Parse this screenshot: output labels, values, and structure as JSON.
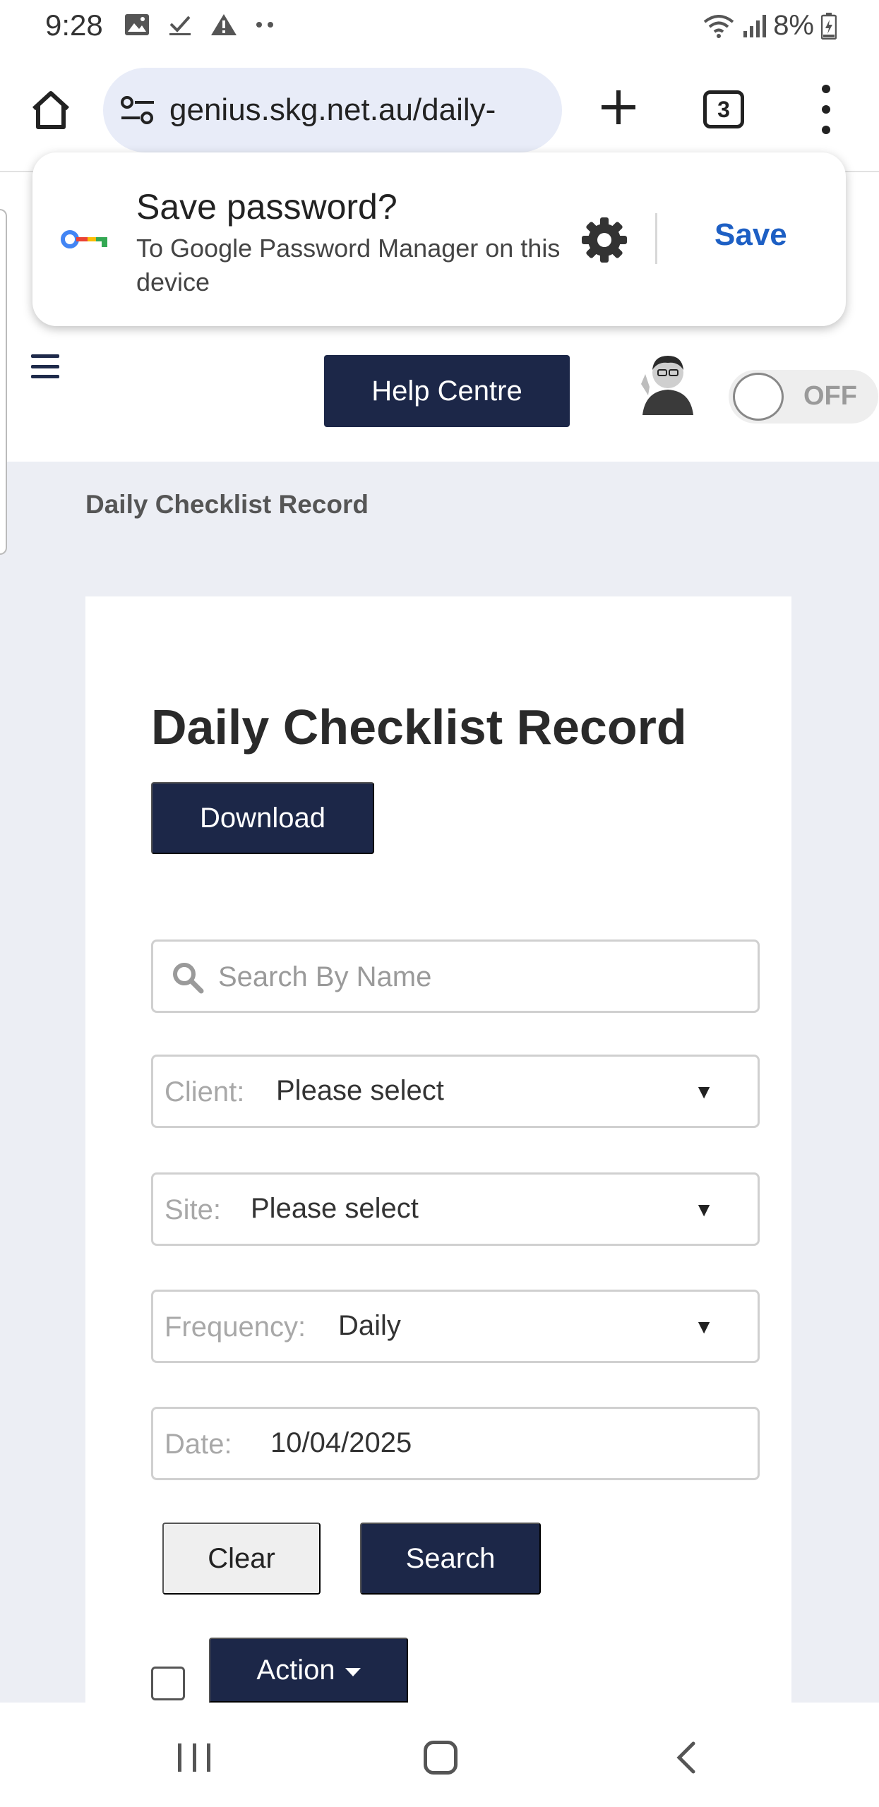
{
  "status_bar": {
    "time": "9:28",
    "battery": "8%"
  },
  "browser": {
    "url": "genius.skg.net.au/daily-",
    "tab_count": "3"
  },
  "password_prompt": {
    "title": "Save password?",
    "subtitle": "To Google Password Manager on this device",
    "save_label": "Save"
  },
  "header": {
    "help_label": "Help Centre",
    "toggle_label": "OFF"
  },
  "breadcrumb": "Daily Checklist Record",
  "main": {
    "title": "Daily Checklist Record",
    "download_label": "Download",
    "search": {
      "placeholder": "Search By Name"
    },
    "client": {
      "label": "Client:",
      "value": "Please select"
    },
    "site": {
      "label": "Site:",
      "value": "Please select"
    },
    "frequency": {
      "label": "Frequency:",
      "value": "Daily"
    },
    "date": {
      "label": "Date:",
      "value": "10/04/2025"
    },
    "clear_label": "Clear",
    "search_label": "Search",
    "action_label": "Action"
  },
  "colors": {
    "primary": "#1c2748",
    "link": "#1d5fc4",
    "page_bg": "#eceef4"
  }
}
